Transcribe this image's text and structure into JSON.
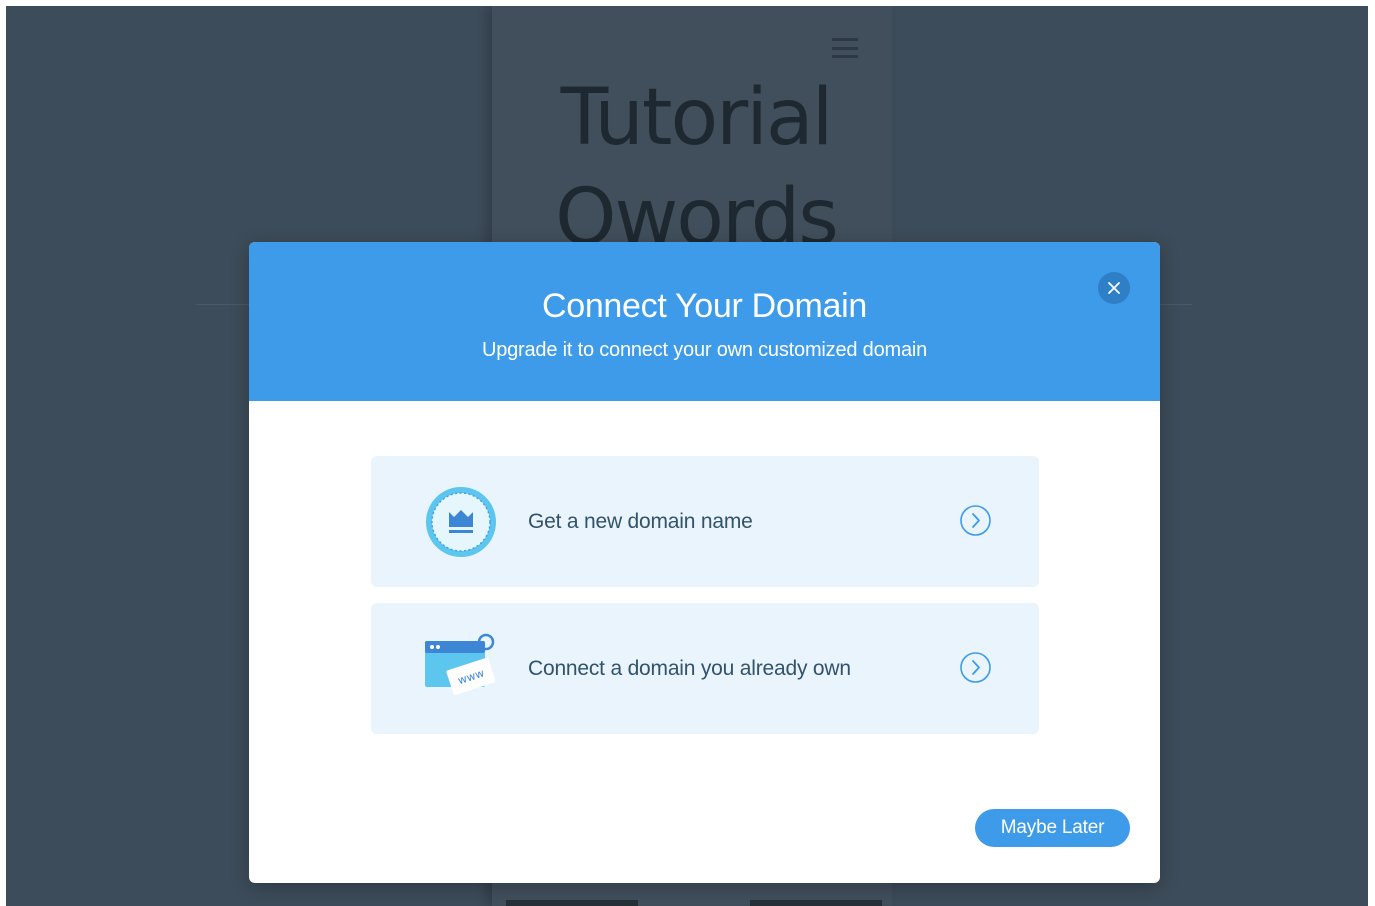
{
  "background_page": {
    "title": "Tutorial Qwords",
    "menu_icon": "hamburger-menu-icon"
  },
  "modal": {
    "title": "Connect Your Domain",
    "subtitle": "Upgrade it to connect your own customized domain",
    "close_icon": "close-icon",
    "options": [
      {
        "label": "Get a new domain name",
        "icon": "crown-badge-icon",
        "arrow_icon": "chevron-right-circle-icon"
      },
      {
        "label": "Connect a domain you already own",
        "icon": "browser-www-tag-icon",
        "arrow_icon": "chevron-right-circle-icon",
        "tag_text": "www"
      }
    ],
    "maybe_later_label": "Maybe Later"
  },
  "colors": {
    "accent": "#3d9be9",
    "overlay": "#3d4c5a",
    "option_bg": "#e9f4fd",
    "option_text": "#32536a"
  }
}
